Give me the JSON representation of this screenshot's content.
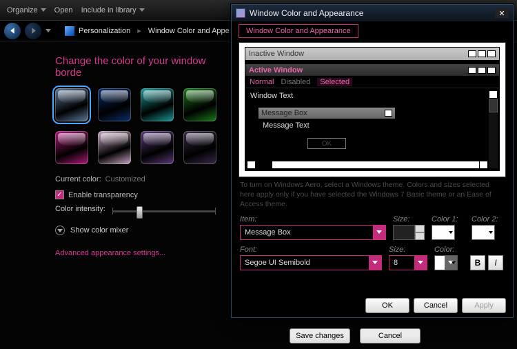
{
  "toolbar": {
    "organize": "Organize",
    "open": "Open",
    "include": "Include in library"
  },
  "breadcrumb": {
    "a": "Personalization",
    "b": "Window Color and Appe..."
  },
  "main": {
    "heading": "Change the color of your window borde",
    "swatches": [
      {
        "color": "#5a7a9a"
      },
      {
        "color": "#0b2f6b"
      },
      {
        "color": "#1a9a9a"
      },
      {
        "color": "#1a7a1a"
      },
      {
        "color": "#b01a7a"
      },
      {
        "color": "#caa6c4"
      },
      {
        "color": "#5a3a7a"
      },
      {
        "color": "#3a2a4a"
      }
    ],
    "current_label": "Current color:",
    "current_value": "Customized",
    "transparency": "Enable transparency",
    "intensity": "Color intensity:",
    "mixer": "Show color mixer",
    "advanced": "Advanced appearance settings...",
    "save": "Save changes",
    "cancel": "Cancel"
  },
  "dialog": {
    "title": "Window Color and Appearance",
    "tab": "Window Color and Appearance",
    "preview": {
      "inactive": "Inactive Window",
      "active": "Active Window",
      "menu": {
        "normal": "Normal",
        "disabled": "Disabled",
        "selected": "Selected"
      },
      "window_text": "Window Text",
      "msgbox_title": "Message Box",
      "msgbox_text": "Message Text",
      "msgbox_ok": "OK"
    },
    "hint": "To turn on Windows Aero, select a Windows theme. Colors and sizes selected here apply only if you have selected the Windows 7 Basic theme or an Ease of Access theme.",
    "item_label": "Item:",
    "item_value": "Message Box",
    "size_label": "Size:",
    "size_value": "",
    "color1_label": "Color 1:",
    "color2_label": "Color 2:",
    "font_label": "Font:",
    "font_value": "Segoe UI Semibold",
    "font_size_label": "Size:",
    "font_size_value": "8",
    "font_color_label": "Color:",
    "bold": "B",
    "italic": "I",
    "ok": "OK",
    "cancel": "Cancel",
    "apply": "Apply"
  }
}
